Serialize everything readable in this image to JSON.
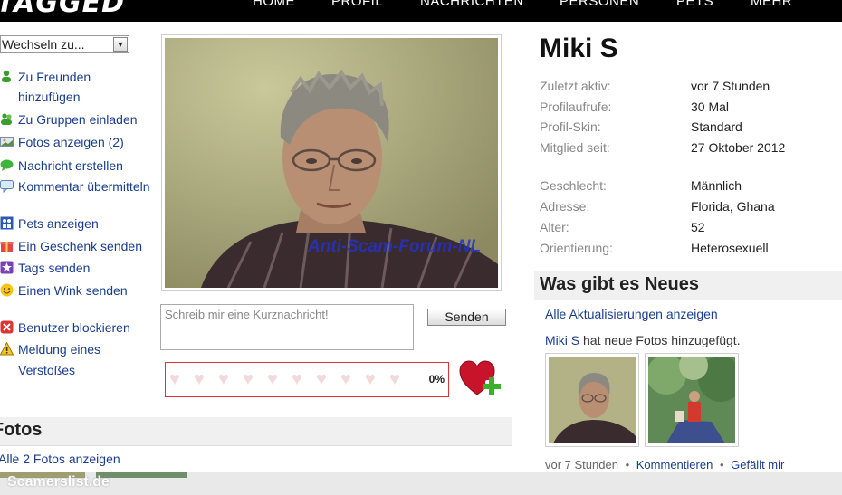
{
  "header": {
    "logo": "TAGGED",
    "nav": [
      "HOME",
      "PROFIL",
      "NACHRICHTEN",
      "PERSONEN",
      "PETS",
      "MEHR"
    ]
  },
  "sidebar": {
    "dropdown": "Wechseln zu...",
    "items": [
      {
        "label": "Zu Freunden",
        "label2": "hinzufügen",
        "icon": "add-friend-icon"
      },
      {
        "label": "Zu Gruppen einladen",
        "icon": "group-invite-icon"
      },
      {
        "label": "Fotos anzeigen (2)",
        "icon": "photos-icon"
      },
      {
        "label": "Nachricht erstellen",
        "icon": "message-icon"
      },
      {
        "label": "Kommentar übermitteln",
        "icon": "comment-icon"
      },
      {
        "label": "Pets anzeigen",
        "icon": "pets-icon"
      },
      {
        "label": "Ein Geschenk senden",
        "icon": "gift-icon"
      },
      {
        "label": "Tags senden",
        "icon": "star-icon"
      },
      {
        "label": "Einen Wink senden",
        "icon": "smiley-icon"
      },
      {
        "label": "Benutzer blockieren",
        "icon": "block-icon"
      },
      {
        "label": "Meldung eines",
        "label2": "Verstoßes",
        "icon": "warning-icon"
      }
    ]
  },
  "photo": {
    "watermark": "Anti-Scam-Forum-NL"
  },
  "composer": {
    "placeholder": "Schreib mir eine Kurznachricht!",
    "send_label": "Senden"
  },
  "meter": {
    "percent": "0%",
    "hearts": 10
  },
  "fotos": {
    "title": "Fotos",
    "link": "Alle 2 Fotos anzeigen"
  },
  "profile": {
    "name": "Miki S",
    "rows": [
      {
        "k": "Zuletzt aktiv:",
        "v": "vor 7 Stunden"
      },
      {
        "k": "Profilaufrufe:",
        "v": "30 Mal"
      },
      {
        "k": "Profil-Skin:",
        "v": "Standard"
      },
      {
        "k": "Mitglied seit:",
        "v": "27 Oktober 2012"
      },
      {
        "k": "Geschlecht:",
        "v": "Männlich"
      },
      {
        "k": "Adresse:",
        "v": "Florida, Ghana"
      },
      {
        "k": "Alter:",
        "v": "52"
      },
      {
        "k": "Orientierung:",
        "v": "Heterosexuell"
      }
    ]
  },
  "news": {
    "title": "Was gibt es Neues",
    "link": "Alle Aktualisierungen anzeigen",
    "activity_name": "Miki S",
    "activity_text": " hat neue Fotos hinzugefügt.",
    "time": "vor 7 Stunden",
    "comment": "Kommentieren",
    "like": "Gefällt mir",
    "bullet": "•"
  },
  "footer": {
    "watermark": "Scamerslist.de"
  },
  "colors": {
    "link": "#1a3d8f",
    "accent_red": "#d33333",
    "topbar": "#000000"
  }
}
